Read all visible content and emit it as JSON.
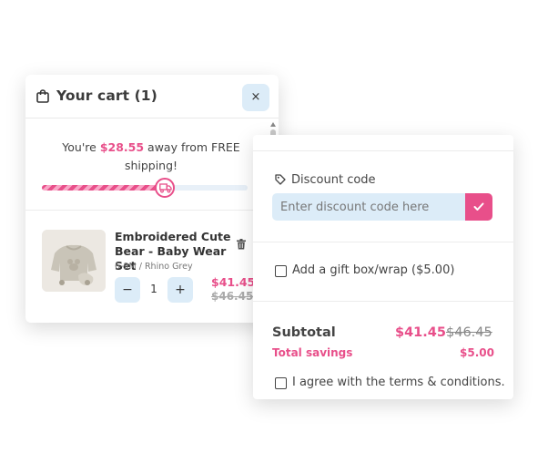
{
  "colors": {
    "accent": "#e84f8a",
    "soft_blue": "#dcecf8"
  },
  "cart": {
    "title": "Your cart (1)",
    "close_label": "×",
    "shipping": {
      "prefix": "You're ",
      "amount": "$28.55",
      "suffix": " away from FREE shipping!",
      "progress_percent": 59
    },
    "item": {
      "name": "Embroidered Cute Bear - Baby Wear Set",
      "variant": "6-9M / Rhino Grey",
      "quantity": "1",
      "minus_label": "−",
      "plus_label": "+",
      "price": "$41.45",
      "compare_price": "$46.45"
    }
  },
  "checkout": {
    "discount": {
      "label": "Discount code",
      "placeholder": "Enter discount code here"
    },
    "gift_label": "Add a gift box/wrap ($5.00)",
    "subtotal": {
      "label": "Subtotal",
      "price": "$41.45",
      "compare_price": "$46.45"
    },
    "savings": {
      "label": "Total savings",
      "value": "$5.00"
    },
    "terms_label": "I agree with the terms & conditions."
  },
  "icons": [
    "bag-icon",
    "close-icon",
    "truck-icon",
    "trash-icon",
    "tag-icon",
    "check-icon"
  ]
}
